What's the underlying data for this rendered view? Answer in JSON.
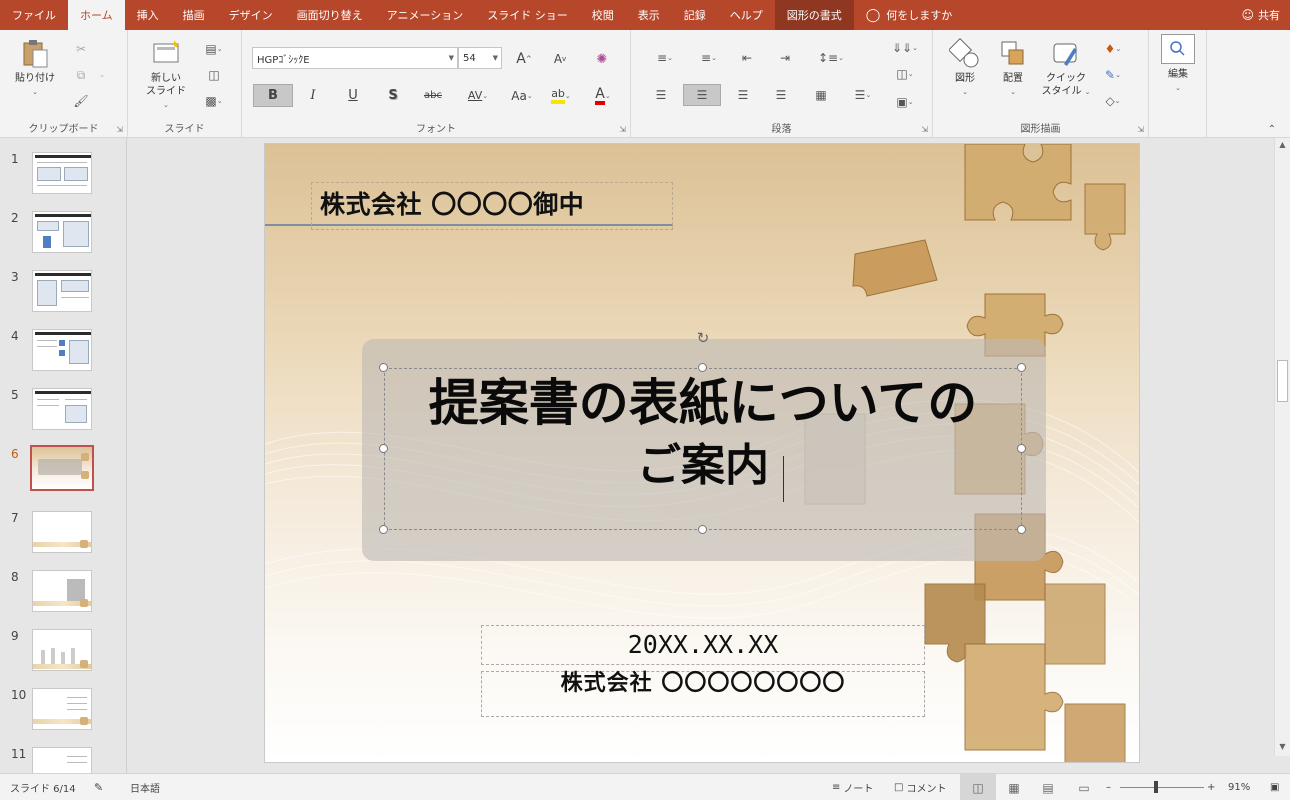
{
  "tabs": [
    "ファイル",
    "ホーム",
    "挿入",
    "描画",
    "デザイン",
    "画面切り替え",
    "アニメーション",
    "スライド ショー",
    "校閲",
    "表示",
    "記録",
    "ヘルプ",
    "図形の書式"
  ],
  "active_tab": "ホーム",
  "tell_me": "何をしますか",
  "share": "共有",
  "ribbon": {
    "clipboard": {
      "paste": "貼り付け",
      "label": "クリップボード"
    },
    "slides": {
      "new_slide": "新しい\nスライド",
      "label": "スライド"
    },
    "font": {
      "name": "HGPｺﾞｼｯｸE",
      "size": "54",
      "bold": "B",
      "italic": "I",
      "underline": "U",
      "shadow": "S",
      "strike": "abc",
      "spacing": "AV",
      "case": "Aa",
      "color_letter": "A",
      "grow": "A",
      "shrink": "A",
      "label": "フォント"
    },
    "paragraph": {
      "label": "段落"
    },
    "drawing": {
      "shapes": "図形",
      "arrange": "配置",
      "quick_styles": "クイック\nスタイル",
      "label": "図形描画"
    },
    "editing": {
      "label": "編集"
    }
  },
  "thumbnails": [
    {
      "num": "1"
    },
    {
      "num": "2"
    },
    {
      "num": "3"
    },
    {
      "num": "4"
    },
    {
      "num": "5"
    },
    {
      "num": "6"
    },
    {
      "num": "7"
    },
    {
      "num": "8"
    },
    {
      "num": "9"
    },
    {
      "num": "10"
    },
    {
      "num": "11"
    }
  ],
  "active_slide": "6",
  "slide": {
    "recipient": "株式会社 〇〇〇〇御中",
    "title_line1": "提案書の表紙についての",
    "title_line2": "ご案内",
    "date": "20XX.XX.XX",
    "company": "株式会社 〇〇〇〇〇〇〇〇"
  },
  "status": {
    "slide_position": "スライド 6/14",
    "language": "日本語",
    "notes": "ノート",
    "comments": "コメント",
    "zoom": "91%"
  },
  "colors": {
    "accent": "#b7472a",
    "selected_thumb": "#c0504d"
  }
}
